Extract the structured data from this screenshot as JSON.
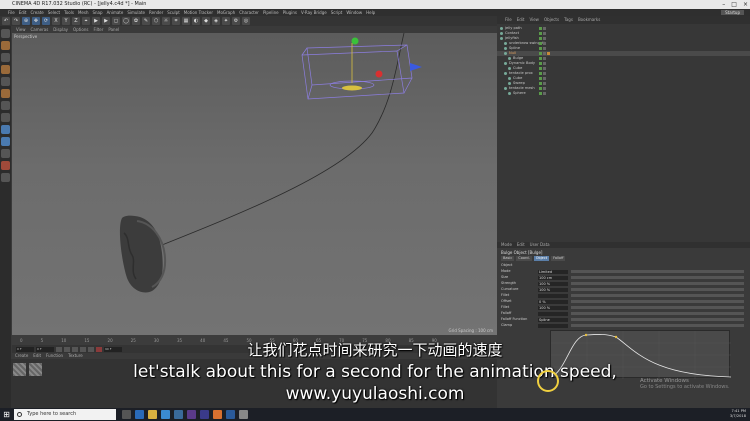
{
  "window": {
    "title": "CINEMA 4D R17.032 Studio (RC) - [jelly4.c4d *] - Main",
    "controls": [
      "–",
      "□",
      "×"
    ]
  },
  "menubar": {
    "items": [
      "File",
      "Edit",
      "Create",
      "Select",
      "Tools",
      "Mesh",
      "Snap",
      "Animate",
      "Simulate",
      "Render",
      "Sculpt",
      "Motion Tracker",
      "MoGraph",
      "Character",
      "Pipeline",
      "Plugins",
      "V-Ray Bridge",
      "Script",
      "Window",
      "Help"
    ],
    "layout_label": "Startup"
  },
  "toolbar": {
    "buttons": [
      "↶",
      "↷",
      "⊕",
      "✥",
      "⟳",
      "X",
      "Y",
      "Z",
      "⌖",
      "▶",
      "▶",
      "◻",
      "◯",
      "✿",
      "✎",
      "⬡",
      "☼",
      "⌗",
      "▦",
      "◐",
      "◆",
      "◈",
      "✦",
      "⚙",
      "◎"
    ]
  },
  "viewport": {
    "menu": [
      "View",
      "Cameras",
      "Display",
      "Options",
      "Filter",
      "Panel"
    ],
    "label": "Perspective",
    "grid_spacing": "Grid Spacing : 100 cm"
  },
  "timeline": {
    "ticks": [
      "0",
      "5",
      "10",
      "15",
      "20",
      "25",
      "30",
      "35",
      "40",
      "45",
      "50",
      "55",
      "60",
      "65",
      "70",
      "75",
      "80",
      "85",
      "90"
    ],
    "current_frame": "0 F",
    "start_frame": "0 F",
    "end_frame": "90 F"
  },
  "material_manager": {
    "menu": [
      "Create",
      "Edit",
      "Function",
      "Texture"
    ]
  },
  "object_manager": {
    "tabs": [
      "File",
      "Edit",
      "View",
      "Objects",
      "Tags",
      "Bookmarks"
    ],
    "rows": [
      {
        "name": "jelly path",
        "indent": 0,
        "orange": false
      },
      {
        "name": "Contact",
        "indent": 0,
        "orange": false
      },
      {
        "name": "jellyfish",
        "indent": 0,
        "orange": false
      },
      {
        "name": "underbrow swingeth",
        "indent": 1,
        "orange": false
      },
      {
        "name": "Spline",
        "indent": 1,
        "orange": false
      },
      {
        "name": "Null",
        "indent": 1,
        "orange": true
      },
      {
        "name": "Bulge",
        "indent": 2,
        "orange": false
      },
      {
        "name": "Dynamic Body",
        "indent": 1,
        "orange": false
      },
      {
        "name": "Cube",
        "indent": 2,
        "orange": false
      },
      {
        "name": "tentacle prox",
        "indent": 1,
        "orange": false
      },
      {
        "name": "Cube",
        "indent": 2,
        "orange": false
      },
      {
        "name": "Sweep",
        "indent": 2,
        "orange": false
      },
      {
        "name": "tentacle mesh",
        "indent": 1,
        "orange": false
      },
      {
        "name": "Sphere",
        "indent": 2,
        "orange": false
      }
    ]
  },
  "attributes": {
    "tabs": [
      "Mode",
      "Edit",
      "User Data"
    ],
    "title": "Bulge Object [Bulge]",
    "subtabs": [
      "Basic",
      "Coord.",
      "Object",
      "Falloff"
    ],
    "section": "Object",
    "rows": [
      {
        "label": "Mode",
        "value": "Limited"
      },
      {
        "label": "Size",
        "value": "100 cm"
      },
      {
        "label": "Strength",
        "value": "100 %"
      },
      {
        "label": "Curvature",
        "value": "100 %"
      },
      {
        "label": "Fillet",
        "value": ""
      },
      {
        "label": "Offset",
        "value": "0 %"
      },
      {
        "label": "Fillet",
        "value": "100 %"
      },
      {
        "label": "Falloff",
        "value": ""
      },
      {
        "label": "Falloff Function",
        "value": "Spline"
      },
      {
        "label": "Clamp",
        "value": ""
      }
    ]
  },
  "windows_activation": {
    "line1": "Activate Windows",
    "line2": "Go to Settings to activate Windows."
  },
  "subtitles": {
    "chinese": "让我们花点时间来研究一下动画的速度",
    "english": "let'stalk about this for a second for the animation speed,",
    "website": "www.yuyulaoshi.com"
  },
  "taskbar": {
    "search_placeholder": "Type here to search",
    "time": "7:41 PM",
    "date": "3/7/2018"
  }
}
